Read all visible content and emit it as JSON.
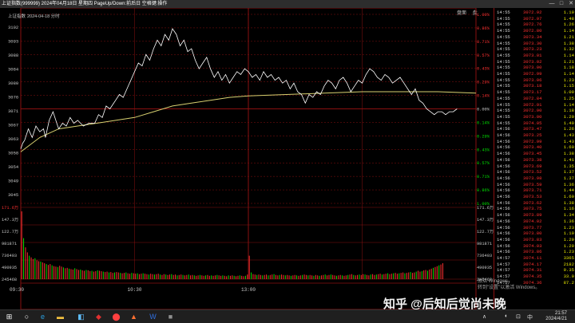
{
  "window": {
    "title": "上证指数(999999) 2024年04月18日 星期四 PageUp/Down:前后日 空格键:操作",
    "controls": [
      "—",
      "□",
      "✕"
    ]
  },
  "chart_header": {
    "index_name": "上证指数",
    "date_label": "2024-04-18 分时"
  },
  "top_tabs": [
    "盘面",
    "盘"
  ],
  "colors": {
    "red": "#ff3030",
    "green": "#00e000",
    "line": "#ffffff",
    "avg": "#d8d070",
    "grid": "#8a1010"
  },
  "price_axis": {
    "left_labels": [
      "3102",
      "3093",
      "3088",
      "3084",
      "3080",
      "3076",
      "3071",
      "3067",
      "3063",
      "3058",
      "3054",
      "3049",
      "3045"
    ],
    "right_labels": [
      "1.00%",
      "0.86%",
      "0.71%",
      "0.57%",
      "0.43%",
      "0.29%",
      "0.14%",
      "0.00%",
      "0.14%",
      "0.29%",
      "0.43%",
      "0.57%",
      "0.71%",
      "0.86%",
      "1.00%"
    ]
  },
  "volume_axis": {
    "labels": [
      "171.6万",
      "147.3万",
      "122.7万",
      "981871",
      "736403",
      "490935",
      "245468"
    ]
  },
  "time_axis": [
    "09:30",
    "10:30",
    "13:00"
  ],
  "chart_data": {
    "type": "line",
    "title": "上证指数 2024-04-18 分时",
    "x_unit": "minute",
    "x_range": [
      0,
      240
    ],
    "ylim": [
      3040,
      3106
    ],
    "base_price": 3071,
    "price_series": [
      [
        0,
        3059
      ],
      [
        1,
        3061
      ],
      [
        2,
        3062
      ],
      [
        4,
        3066
      ],
      [
        6,
        3063
      ],
      [
        8,
        3067
      ],
      [
        10,
        3065
      ],
      [
        12,
        3066
      ],
      [
        13,
        3063
      ],
      [
        15,
        3069
      ],
      [
        17,
        3072
      ],
      [
        19,
        3068
      ],
      [
        20,
        3066
      ],
      [
        22,
        3068
      ],
      [
        24,
        3067
      ],
      [
        26,
        3070
      ],
      [
        28,
        3068
      ],
      [
        30,
        3069
      ],
      [
        33,
        3067
      ],
      [
        36,
        3068
      ],
      [
        39,
        3068
      ],
      [
        41,
        3071
      ],
      [
        43,
        3070
      ],
      [
        45,
        3074
      ],
      [
        47,
        3073
      ],
      [
        50,
        3076
      ],
      [
        52,
        3078
      ],
      [
        54,
        3077
      ],
      [
        56,
        3080
      ],
      [
        58,
        3083
      ],
      [
        60,
        3086
      ],
      [
        62,
        3089
      ],
      [
        64,
        3088
      ],
      [
        66,
        3092
      ],
      [
        68,
        3090
      ],
      [
        70,
        3094
      ],
      [
        72,
        3097
      ],
      [
        74,
        3095
      ],
      [
        76,
        3099
      ],
      [
        78,
        3097
      ],
      [
        80,
        3101
      ],
      [
        82,
        3099
      ],
      [
        84,
        3095
      ],
      [
        86,
        3097
      ],
      [
        88,
        3093
      ],
      [
        90,
        3094
      ],
      [
        92,
        3090
      ],
      [
        94,
        3087
      ],
      [
        96,
        3089
      ],
      [
        98,
        3091
      ],
      [
        100,
        3087
      ],
      [
        102,
        3084
      ],
      [
        104,
        3086
      ],
      [
        106,
        3083
      ],
      [
        108,
        3085
      ],
      [
        110,
        3082
      ],
      [
        112,
        3084
      ],
      [
        114,
        3086
      ],
      [
        116,
        3085
      ],
      [
        118,
        3087
      ],
      [
        120,
        3086
      ],
      [
        122,
        3084
      ],
      [
        124,
        3085
      ],
      [
        126,
        3083
      ],
      [
        128,
        3086
      ],
      [
        130,
        3084
      ],
      [
        132,
        3085
      ],
      [
        134,
        3083
      ],
      [
        136,
        3084
      ],
      [
        138,
        3082
      ],
      [
        140,
        3083
      ],
      [
        142,
        3080
      ],
      [
        144,
        3082
      ],
      [
        146,
        3079
      ],
      [
        148,
        3078
      ],
      [
        150,
        3075
      ],
      [
        152,
        3078
      ],
      [
        154,
        3077
      ],
      [
        156,
        3079
      ],
      [
        158,
        3078
      ],
      [
        160,
        3081
      ],
      [
        162,
        3083
      ],
      [
        164,
        3082
      ],
      [
        166,
        3080
      ],
      [
        168,
        3083
      ],
      [
        170,
        3084
      ],
      [
        172,
        3082
      ],
      [
        174,
        3079
      ],
      [
        176,
        3081
      ],
      [
        178,
        3083
      ],
      [
        180,
        3082
      ],
      [
        182,
        3085
      ],
      [
        184,
        3087
      ],
      [
        186,
        3086
      ],
      [
        188,
        3084
      ],
      [
        190,
        3083
      ],
      [
        192,
        3085
      ],
      [
        194,
        3084
      ],
      [
        196,
        3082
      ],
      [
        198,
        3083
      ],
      [
        200,
        3084
      ],
      [
        202,
        3082
      ],
      [
        204,
        3080
      ],
      [
        206,
        3078
      ],
      [
        208,
        3080
      ],
      [
        210,
        3076
      ],
      [
        212,
        3075
      ],
      [
        214,
        3073
      ],
      [
        216,
        3072
      ],
      [
        218,
        3071
      ],
      [
        220,
        3072
      ],
      [
        222,
        3072
      ],
      [
        224,
        3071
      ],
      [
        226,
        3072
      ],
      [
        228,
        3072
      ],
      [
        230,
        3073
      ]
    ],
    "avg_series": [
      [
        0,
        3058
      ],
      [
        10,
        3063
      ],
      [
        20,
        3066
      ],
      [
        30,
        3067
      ],
      [
        40,
        3068
      ],
      [
        50,
        3069
      ],
      [
        60,
        3070
      ],
      [
        70,
        3072
      ],
      [
        80,
        3074
      ],
      [
        90,
        3075
      ],
      [
        100,
        3076
      ],
      [
        110,
        3077
      ],
      [
        120,
        3077.5
      ],
      [
        140,
        3078
      ],
      [
        160,
        3078.5
      ],
      [
        180,
        3079
      ],
      [
        200,
        3079
      ],
      [
        220,
        3079
      ],
      [
        240,
        3078.5
      ]
    ],
    "volume_max": 1716000,
    "volume": [
      1620000,
      980000,
      760000,
      640000,
      560000,
      520000,
      480000,
      500000,
      450000,
      430000,
      420000,
      400000,
      380000,
      360000,
      340000,
      360000,
      330000,
      310000,
      300000,
      290000,
      320000,
      300000,
      280000,
      260000,
      270000,
      250000,
      240000,
      230000,
      260000,
      240000,
      220000,
      230000,
      210000,
      200000,
      220000,
      210000,
      190000,
      200000,
      180000,
      190000,
      210000,
      200000,
      190000,
      180000,
      170000,
      180000,
      160000,
      170000,
      150000,
      160000,
      170000,
      160000,
      150000,
      140000,
      150000,
      160000,
      140000,
      130000,
      150000,
      140000,
      130000,
      140000,
      120000,
      130000,
      140000,
      130000,
      120000,
      110000,
      130000,
      120000,
      110000,
      120000,
      130000,
      110000,
      100000,
      120000,
      110000,
      100000,
      110000,
      120000,
      100000,
      110000,
      90000,
      100000,
      110000,
      100000,
      90000,
      100000,
      110000,
      90000,
      100000,
      90000,
      80000,
      90000,
      100000,
      90000,
      80000,
      90000,
      100000,
      80000,
      90000,
      80000,
      90000,
      100000,
      90000,
      80000,
      90000,
      80000,
      70000,
      90000,
      80000,
      90000,
      80000,
      70000,
      80000,
      90000,
      80000,
      70000,
      80000,
      110000,
      560000,
      160000,
      120000,
      110000,
      100000,
      110000,
      100000,
      90000,
      100000,
      110000,
      90000,
      100000,
      110000,
      120000,
      100000,
      90000,
      100000,
      110000,
      100000,
      90000,
      100000,
      90000,
      80000,
      90000,
      100000,
      90000,
      80000,
      90000,
      100000,
      110000,
      100000,
      90000,
      100000,
      90000,
      80000,
      100000,
      90000,
      80000,
      90000,
      100000,
      110000,
      90000,
      100000,
      110000,
      100000,
      90000,
      80000,
      90000,
      100000,
      90000,
      80000,
      90000,
      100000,
      110000,
      120000,
      100000,
      90000,
      100000,
      110000,
      100000,
      120000,
      110000,
      100000,
      90000,
      110000,
      120000,
      100000,
      110000,
      120000,
      130000,
      110000,
      120000,
      130000,
      140000,
      120000,
      130000,
      140000,
      150000,
      130000,
      140000,
      150000,
      160000,
      140000,
      150000,
      160000,
      170000,
      150000,
      160000,
      180000,
      200000,
      180000,
      190000,
      210000,
      220000,
      200000,
      230000,
      250000,
      270000,
      290000,
      310000,
      330000,
      350000,
      380000
    ]
  },
  "ticks": [
    {
      "t": "14:55",
      "p": "3072.92",
      "v": "1.19",
      "c": "r"
    },
    {
      "t": "14:55",
      "p": "3072.97",
      "v": "1.48",
      "c": "r"
    },
    {
      "t": "14:55",
      "p": "3072.76",
      "v": "1.26",
      "c": "r"
    },
    {
      "t": "14:55",
      "p": "3072.80",
      "v": "1.14",
      "c": "r"
    },
    {
      "t": "14:55",
      "p": "3073.34",
      "v": "1.21",
      "c": "r"
    },
    {
      "t": "14:55",
      "p": "3073.30",
      "v": "1.38",
      "c": "r"
    },
    {
      "t": "14:55",
      "p": "3073.23",
      "v": "1.32",
      "c": "r"
    },
    {
      "t": "14:55",
      "p": "3073.01",
      "v": "1.14",
      "c": "r"
    },
    {
      "t": "14:55",
      "p": "3073.02",
      "v": "1.21",
      "c": "r"
    },
    {
      "t": "14:55",
      "p": "3073.00",
      "v": "1.18",
      "c": "r"
    },
    {
      "t": "14:55",
      "p": "3072.99",
      "v": "1.14",
      "c": "r"
    },
    {
      "t": "14:55",
      "p": "3073.06",
      "v": "1.23",
      "c": "r"
    },
    {
      "t": "14:55",
      "p": "3073.18",
      "v": "1.15",
      "c": "r"
    },
    {
      "t": "14:55",
      "p": "3073.17",
      "v": "1.09",
      "c": "r"
    },
    {
      "t": "14:55",
      "p": "3072.84",
      "v": "1.25",
      "c": "r"
    },
    {
      "t": "14:55",
      "p": "3072.91",
      "v": "1.14",
      "c": "r"
    },
    {
      "t": "14:55",
      "p": "3072.90",
      "v": "1.18",
      "c": "r"
    },
    {
      "t": "14:55",
      "p": "3073.00",
      "v": "1.20",
      "c": "r"
    },
    {
      "t": "14:55",
      "p": "3074.05",
      "v": "1.49",
      "c": "r"
    },
    {
      "t": "14:56",
      "p": "3073.47",
      "v": "1.26",
      "c": "r"
    },
    {
      "t": "14:56",
      "p": "3073.25",
      "v": "1.43",
      "c": "r"
    },
    {
      "t": "14:56",
      "p": "3072.99",
      "v": "1.43",
      "c": "r"
    },
    {
      "t": "14:56",
      "p": "3073.40",
      "v": "1.60",
      "c": "r"
    },
    {
      "t": "14:56",
      "p": "3073.45",
      "v": "1.38",
      "c": "r"
    },
    {
      "t": "14:56",
      "p": "3073.38",
      "v": "1.41",
      "c": "r"
    },
    {
      "t": "14:56",
      "p": "3073.69",
      "v": "1.35",
      "c": "r"
    },
    {
      "t": "14:56",
      "p": "3073.52",
      "v": "1.37",
      "c": "r"
    },
    {
      "t": "14:56",
      "p": "3073.98",
      "v": "1.37",
      "c": "r"
    },
    {
      "t": "14:56",
      "p": "3073.59",
      "v": "1.36",
      "c": "r"
    },
    {
      "t": "14:56",
      "p": "3073.71",
      "v": "1.44",
      "c": "r"
    },
    {
      "t": "14:56",
      "p": "3073.53",
      "v": "1.60",
      "c": "r"
    },
    {
      "t": "14:56",
      "p": "3073.62",
      "v": "1.38",
      "c": "r"
    },
    {
      "t": "14:56",
      "p": "3073.75",
      "v": "1.16",
      "c": "r"
    },
    {
      "t": "14:56",
      "p": "3073.89",
      "v": "1.34",
      "c": "r"
    },
    {
      "t": "14:56",
      "p": "3074.02",
      "v": "1.36",
      "c": "r"
    },
    {
      "t": "14:56",
      "p": "3073.77",
      "v": "1.23",
      "c": "r"
    },
    {
      "t": "14:56",
      "p": "3073.80",
      "v": "1.19",
      "c": "r"
    },
    {
      "t": "14:56",
      "p": "3073.83",
      "v": "1.29",
      "c": "r"
    },
    {
      "t": "14:56",
      "p": "3074.03",
      "v": "1.29",
      "c": "r"
    },
    {
      "t": "14:56",
      "p": "3073.86",
      "v": "1.23",
      "c": "r"
    },
    {
      "t": "14:57",
      "p": "3074.11",
      "v": "3365",
      "c": "r"
    },
    {
      "t": "14:57",
      "p": "3074.17",
      "v": "2182",
      "c": "r"
    },
    {
      "t": "14:57",
      "p": "3074.31",
      "v": "9.35",
      "c": "r"
    },
    {
      "t": "14:57",
      "p": "3074.35",
      "v": "33.0",
      "c": "r"
    },
    {
      "t": "14:57",
      "p": "3074.36",
      "v": "87.2",
      "c": "r"
    }
  ],
  "watermark": "知乎 @后知后觉尚未晚",
  "activate_windows": [
    "激活 Windows",
    "转到\"设置\"以激活 Windows。"
  ],
  "taskbar": {
    "time": "21:57",
    "date": "2024/4/21"
  }
}
